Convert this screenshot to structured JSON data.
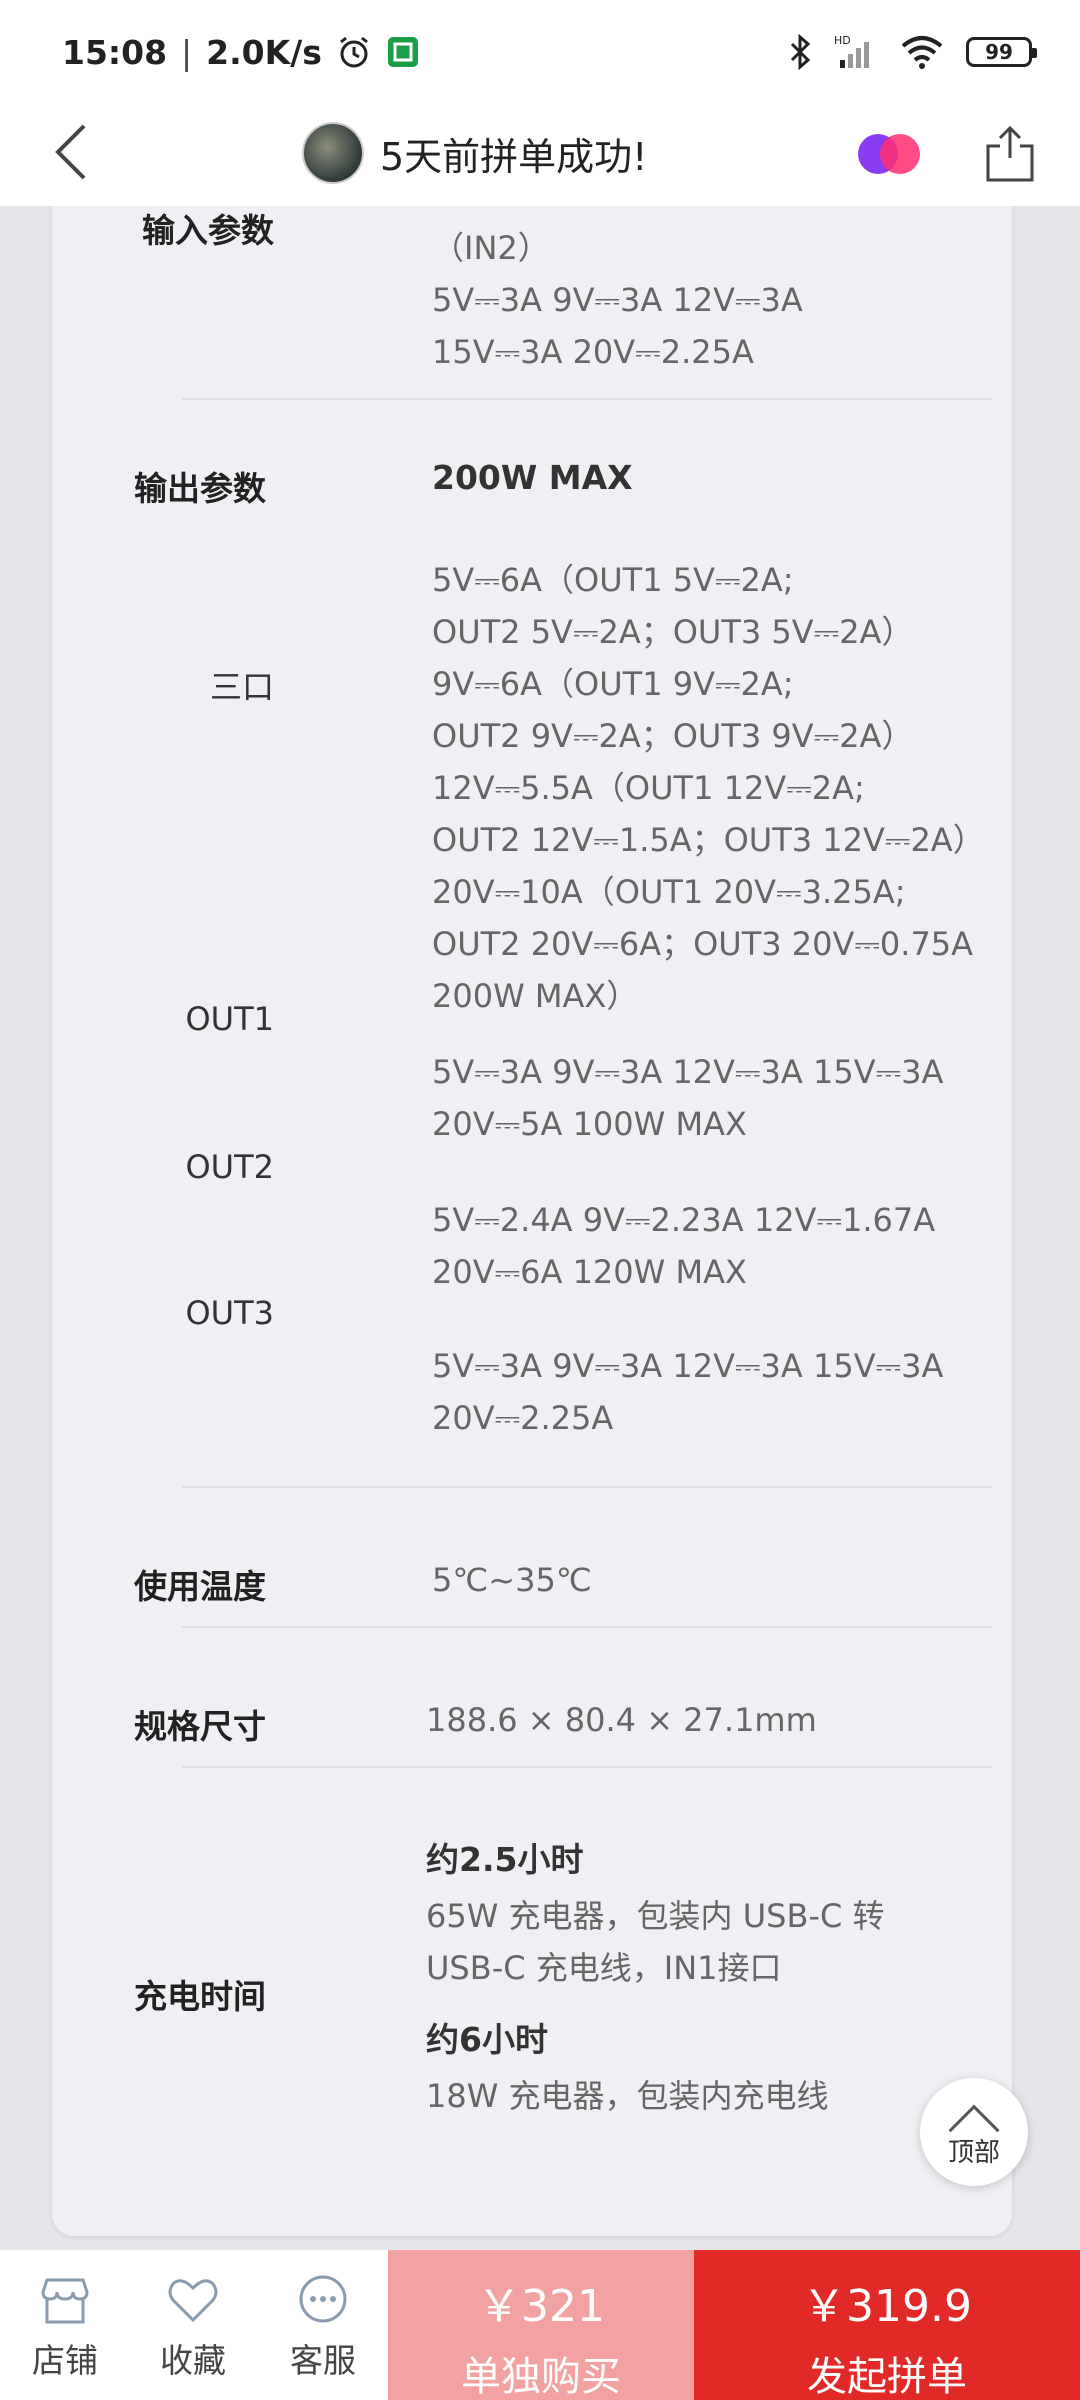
{
  "status_bar": {
    "time": "15:08",
    "separator": "|",
    "speed": "2.0K/s",
    "battery": "99",
    "network": "HD"
  },
  "nav": {
    "title": "5天前拼单成功!"
  },
  "spec": {
    "input_label": "输入参数",
    "input_lines": [
      "（IN2）",
      "5V⎓3A 9V⎓3A 12V⎓3A",
      "15V⎓3A 20V⎓2.25A"
    ],
    "output_label": "输出参数",
    "output_max": "200W MAX",
    "three_port_label": "三口",
    "three_port_lines": [
      "5V⎓6A（OUT1 5V⎓2A;",
      "OUT2 5V⎓2A；OUT3 5V⎓2A）",
      "9V⎓6A（OUT1 9V⎓2A;",
      "OUT2 9V⎓2A；OUT3 9V⎓2A）",
      "12V⎓5.5A（OUT1 12V⎓2A;",
      "OUT2 12V⎓1.5A；OUT3 12V⎓2A）",
      "20V⎓10A（OUT1 20V⎓3.25A;",
      "OUT2 20V⎓6A；OUT3 20V⎓0.75A",
      "200W MAX）"
    ],
    "out1_label": "OUT1",
    "out1_lines": [
      "5V⎓3A 9V⎓3A 12V⎓3A 15V⎓3A",
      "20V⎓5A 100W MAX"
    ],
    "out2_label": "OUT2",
    "out2_lines": [
      "5V⎓2.4A 9V⎓2.23A 12V⎓1.67A",
      "20V⎓6A 120W MAX"
    ],
    "out3_label": "OUT3",
    "out3_lines": [
      "5V⎓3A 9V⎓3A 12V⎓3A 15V⎓3A",
      "20V⎓2.25A"
    ],
    "temp_label": "使用温度",
    "temp_value": "5℃~35℃",
    "size_label": "规格尺寸",
    "size_value": "188.6 × 80.4 × 27.1mm",
    "charge_label": "充电时间",
    "charge_a_title": "约2.5小时",
    "charge_a_lines": [
      "65W 充电器，包装内 USB-C 转",
      "USB-C 充电线，IN1接口"
    ],
    "charge_b_title": "约6小时",
    "charge_b_lines": [
      "18W 充电器，包装内充电线"
    ]
  },
  "to_top": "顶部",
  "bottom": {
    "shop": "店铺",
    "fav": "收藏",
    "service": "客服",
    "single_price": "￥321",
    "single_label": "单独购买",
    "group_price": "￥319.9",
    "group_label": "发起拼单"
  },
  "colors": {
    "accent_red": "#e12a27",
    "light_red": "#f3a2a2"
  }
}
